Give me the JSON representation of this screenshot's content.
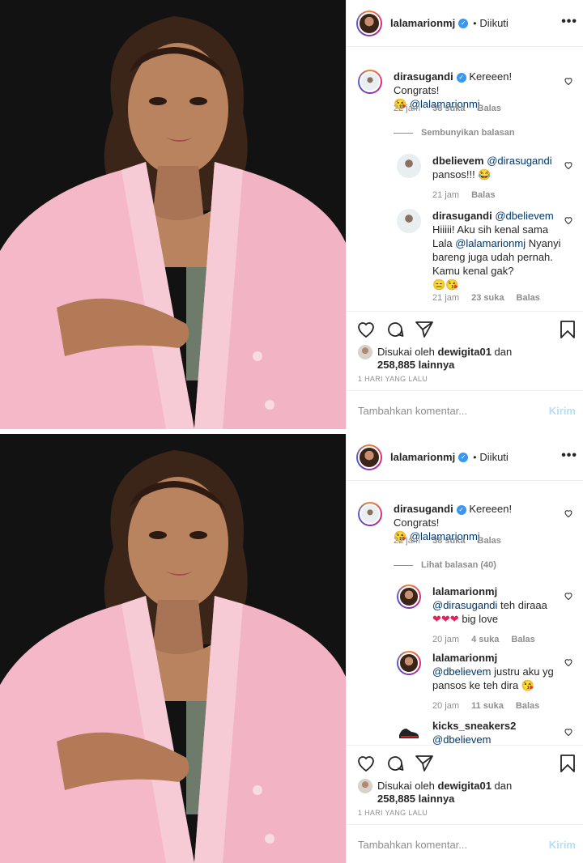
{
  "post1": {
    "header": {
      "username": "lalamarionmj",
      "separator": "•",
      "follow": "Diikuti",
      "more": "•••"
    },
    "comment": {
      "username": "dirasugandi",
      "text": "Kereeen! Congrats!",
      "emoji": "😘",
      "mention": "@lalamarionmj",
      "time": "22 jam",
      "likes": "38 suka",
      "reply": "Balas"
    },
    "toggle": "Sembunyikan balasan",
    "replies": [
      {
        "username": "dbelievem",
        "mention": "@dirasugandi",
        "text": "pansos!!!",
        "emoji": "😂",
        "time": "21 jam",
        "reply": "Balas"
      },
      {
        "username": "dirasugandi",
        "mention": "@dbelievem",
        "text1": "Hiiiii! Aku sih kenal sama Lala",
        "mention2": "@lalamarionmj",
        "text2": "Nyanyi bareng juga udah pernah. Kamu kenal gak?",
        "emoji": "😑😘",
        "time": "21 jam",
        "likes": "23 suka",
        "reply": "Balas"
      }
    ],
    "likes_prefix": "Disukai oleh",
    "likes_user": "dewigita01",
    "likes_and": "dan",
    "likes_count": "258,885 lainnya",
    "ago": "1 HARI YANG LALU",
    "add_placeholder": "Tambahkan komentar...",
    "post_label": "Kirim"
  },
  "post2": {
    "header": {
      "username": "lalamarionmj",
      "separator": "•",
      "follow": "Diikuti",
      "more": "•••"
    },
    "comment": {
      "username": "dirasugandi",
      "text": "Kereeen! Congrats!",
      "emoji": "😘",
      "mention": "@lalamarionmj",
      "time": "22 jam",
      "likes": "38 suka",
      "reply": "Balas"
    },
    "toggle": "Lihat balasan (40)",
    "replies": [
      {
        "username": "lalamarionmj",
        "mention": "@dirasugandi",
        "text": "teh diraaa",
        "emoji": "❤❤❤",
        "text2": "big love",
        "time": "20 jam",
        "likes": "4 suka",
        "reply": "Balas"
      },
      {
        "username": "lalamarionmj",
        "mention": "@dbelievem",
        "text": "justru aku yg pansos ke teh dira",
        "emoji": "😘",
        "time": "20 jam",
        "likes": "11 suka",
        "reply": "Balas"
      },
      {
        "username": "kicks_sneakers2",
        "mention": "@dbelievem"
      }
    ],
    "likes_prefix": "Disukai oleh",
    "likes_user": "dewigita01",
    "likes_and": "dan",
    "likes_count": "258,885 lainnya",
    "ago": "1 HARI YANG LALU",
    "add_placeholder": "Tambahkan komentar...",
    "post_label": "Kirim"
  },
  "colors": {
    "link": "#00376b",
    "verified": "#3897f0",
    "muted": "#8e8e8e",
    "post_disabled": "#b2dffc",
    "heart_red": "#e0245e",
    "cardigan_pink": "#f4b8c8"
  },
  "icons": [
    "heart-icon",
    "comment-icon",
    "share-icon",
    "bookmark-icon",
    "verified-icon",
    "more-icon"
  ]
}
